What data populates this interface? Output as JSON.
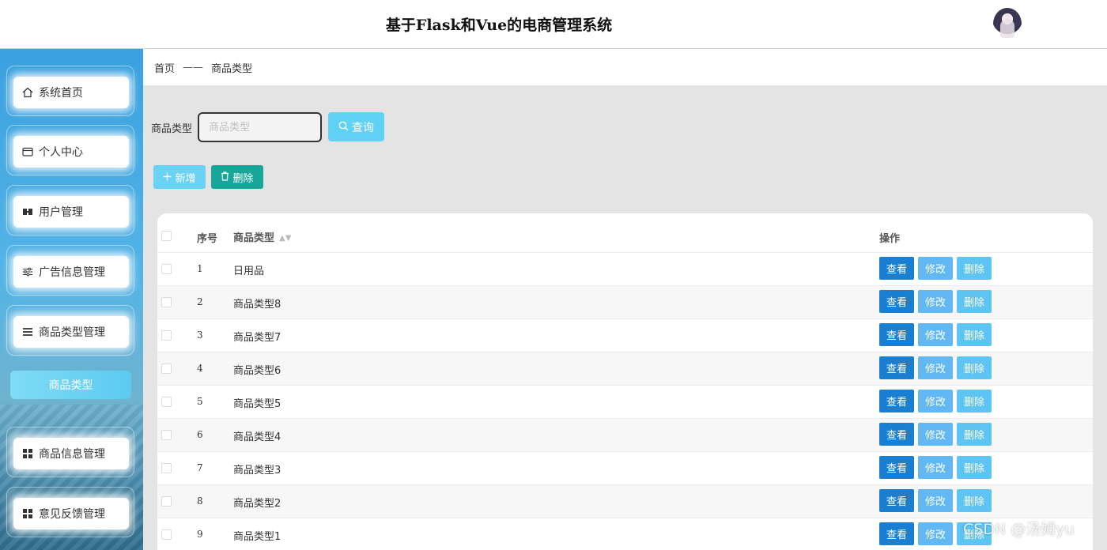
{
  "header": {
    "title": "基于Flask和Vue的电商管理系统"
  },
  "sidebar": {
    "items": [
      {
        "label": "系统首页",
        "icon": "home-icon"
      },
      {
        "label": "个人中心",
        "icon": "wallet-icon"
      },
      {
        "label": "用户管理",
        "icon": "users-icon"
      },
      {
        "label": "广告信息管理",
        "icon": "sliders-icon"
      },
      {
        "label": "商品类型管理",
        "icon": "list-icon"
      },
      {
        "label": "商品信息管理",
        "icon": "grid-icon"
      },
      {
        "label": "意见反馈管理",
        "icon": "grid-icon"
      }
    ],
    "active_sub": "商品类型"
  },
  "breadcrumb": {
    "home": "首页",
    "separator": "——",
    "current": "商品类型"
  },
  "search": {
    "label": "商品类型",
    "placeholder": "商品类型",
    "button": "查询"
  },
  "actions": {
    "add": "新增",
    "delete": "删除"
  },
  "table": {
    "headers": {
      "index": "序号",
      "type": "商品类型",
      "operation": "操作"
    },
    "row_buttons": {
      "view": "查看",
      "edit": "修改",
      "delete": "删除"
    },
    "rows": [
      {
        "index": "1",
        "type": "日用品"
      },
      {
        "index": "2",
        "type": "商品类型8"
      },
      {
        "index": "3",
        "type": "商品类型7"
      },
      {
        "index": "4",
        "type": "商品类型6"
      },
      {
        "index": "5",
        "type": "商品类型5"
      },
      {
        "index": "6",
        "type": "商品类型4"
      },
      {
        "index": "7",
        "type": "商品类型3"
      },
      {
        "index": "8",
        "type": "商品类型2"
      },
      {
        "index": "9",
        "type": "商品类型1"
      }
    ]
  },
  "watermark": "CSDN @汤姆yu"
}
